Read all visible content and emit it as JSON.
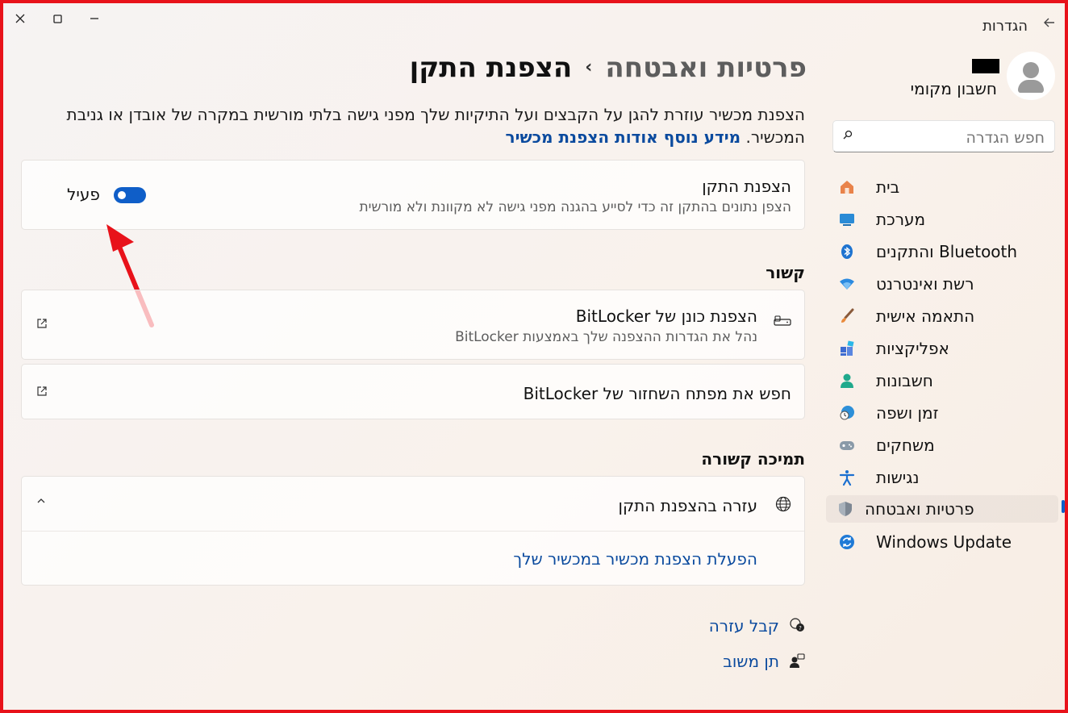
{
  "window": {
    "title": "הגדרות",
    "back_icon": "back-arrow-icon",
    "controls": [
      "minimize",
      "maximize",
      "close"
    ]
  },
  "account": {
    "name": "חשבון מקומי"
  },
  "search": {
    "placeholder": "חפש הגדרה"
  },
  "sidebar": {
    "items": [
      {
        "label": "בית",
        "icon": "home-icon"
      },
      {
        "label": "מערכת",
        "icon": "system-icon"
      },
      {
        "label": "Bluetooth והתקנים",
        "icon": "bluetooth-icon"
      },
      {
        "label": "רשת ואינטרנט",
        "icon": "wifi-icon"
      },
      {
        "label": "התאמה אישית",
        "icon": "brush-icon"
      },
      {
        "label": "אפליקציות",
        "icon": "apps-icon"
      },
      {
        "label": "חשבונות",
        "icon": "accounts-icon"
      },
      {
        "label": "זמן ושפה",
        "icon": "time-language-icon"
      },
      {
        "label": "משחקים",
        "icon": "gaming-icon"
      },
      {
        "label": "נגישות",
        "icon": "accessibility-icon"
      },
      {
        "label": "פרטיות ואבטחה",
        "icon": "shield-icon",
        "active": true
      },
      {
        "label": "Windows Update",
        "icon": "update-icon"
      }
    ]
  },
  "main": {
    "breadcrumb_parent": "פרטיות ואבטחה",
    "breadcrumb_sep": "›",
    "breadcrumb_current": "הצפנת התקן",
    "description": "הצפנת מכשיר עוזרת להגן על הקבצים ועל התיקיות שלך מפני גישה בלתי מורשית במקרה של אובדן או גניבת המכשיר.",
    "learn_more": "מידע נוסף אודות הצפנת מכשיר",
    "toggle_card": {
      "title": "הצפנת התקן",
      "subtitle": "הצפן נתונים בהתקן זה כדי לסייע בהגנה מפני גישה לא מקוונת ולא מורשית",
      "state_label": "פעיל",
      "on": true
    },
    "related_heading": "קשור",
    "related": [
      {
        "title": "הצפנת כונן של BitLocker",
        "subtitle": "נהל את הגדרות ההצפנה שלך באמצעות BitLocker"
      },
      {
        "title": "חפש את מפתח השחזור של BitLocker"
      }
    ],
    "support_heading": "תמיכה קשורה",
    "support": {
      "title": "עזרה בהצפנת התקן",
      "link": "הפעלת הצפנת מכשיר במכשיר שלך"
    },
    "get_help": "קבל עזרה",
    "feedback": "תן משוב"
  },
  "colors": {
    "accent": "#0f5ec8",
    "link": "#0a4a9e",
    "annotation_arrow": "#e8121a",
    "frame": "#e8121a"
  }
}
